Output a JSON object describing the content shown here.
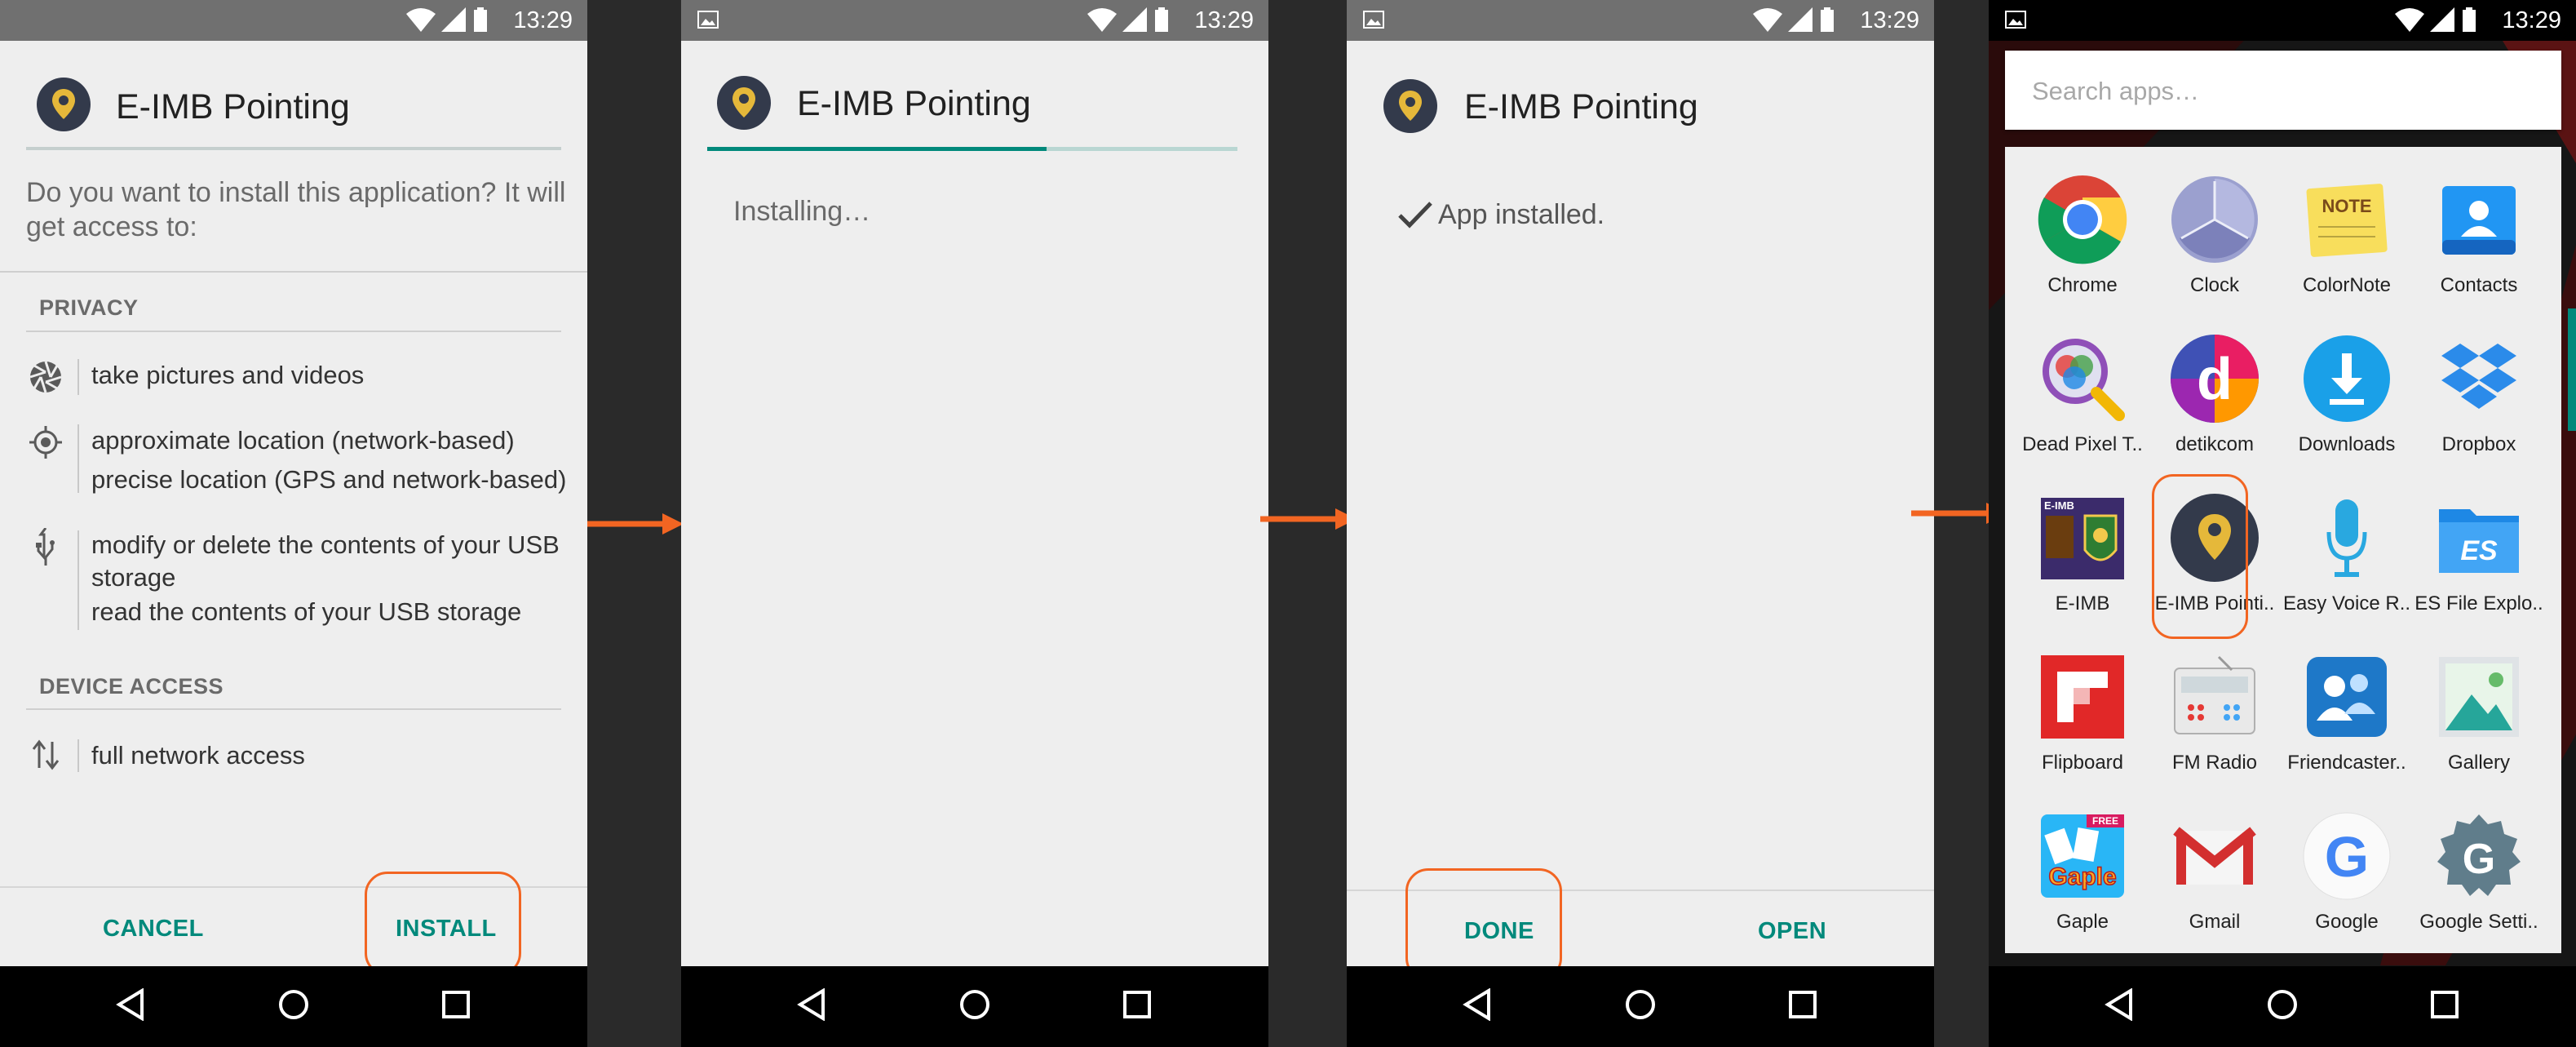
{
  "status": {
    "time": "13:29"
  },
  "app": {
    "name": "E-IMB Pointing"
  },
  "screen1": {
    "question": "Do you want to install this application? It will get access to:",
    "privacy_header": "PRIVACY",
    "perm_camera": "take pictures and videos",
    "perm_location_approx": "approximate location (network-based)",
    "perm_location_precise": "precise location (GPS and network-based)",
    "perm_storage_modify_1": "modify or delete the contents of your USB",
    "perm_storage_modify_2": "storage",
    "perm_storage_read": "read the contents of your USB storage",
    "device_header": "DEVICE ACCESS",
    "perm_network": "full network access",
    "cancel_label": "CANCEL",
    "install_label": "INSTALL"
  },
  "screen2": {
    "status_text": "Installing…",
    "progress": 0.64
  },
  "screen3": {
    "status_text": "App installed.",
    "done_label": "DONE",
    "open_label": "OPEN"
  },
  "screen4": {
    "search_placeholder": "Search apps…",
    "apps": [
      {
        "label": "Chrome",
        "icon": "chrome-icon"
      },
      {
        "label": "Clock",
        "icon": "clock-icon"
      },
      {
        "label": "ColorNote",
        "icon": "colornote-icon",
        "icon_text": "NOTE"
      },
      {
        "label": "Contacts",
        "icon": "contacts-icon"
      },
      {
        "label": "Dead Pixel T..",
        "icon": "dead-pixel-icon"
      },
      {
        "label": "detikcom",
        "icon": "detikcom-icon",
        "icon_text": "d"
      },
      {
        "label": "Downloads",
        "icon": "downloads-icon"
      },
      {
        "label": "Dropbox",
        "icon": "dropbox-icon"
      },
      {
        "label": "E-IMB",
        "icon": "eimb-icon",
        "icon_text": "E-IMB"
      },
      {
        "label": "E-IMB Pointi..",
        "icon": "eimb-pointing-icon"
      },
      {
        "label": "Easy Voice R..",
        "icon": "easy-voice-icon"
      },
      {
        "label": "ES File Explo..",
        "icon": "es-file-icon",
        "icon_text": "ES"
      },
      {
        "label": "Flipboard",
        "icon": "flipboard-icon"
      },
      {
        "label": "FM Radio",
        "icon": "fm-radio-icon"
      },
      {
        "label": "Friendcaster..",
        "icon": "friendcaster-icon"
      },
      {
        "label": "Gallery",
        "icon": "gallery-icon"
      },
      {
        "label": "Gaple",
        "icon": "gaple-icon",
        "icon_text": "Gaple",
        "icon_badge": "FREE"
      },
      {
        "label": "Gmail",
        "icon": "gmail-icon"
      },
      {
        "label": "Google",
        "icon": "google-icon",
        "icon_text": "G"
      },
      {
        "label": "Google Setti..",
        "icon": "google-settings-icon",
        "icon_text": "G"
      }
    ]
  },
  "colors": {
    "accent": "#00897b",
    "highlight": "#f26522",
    "statusbar": "#707070",
    "background": "#eeeeee"
  }
}
